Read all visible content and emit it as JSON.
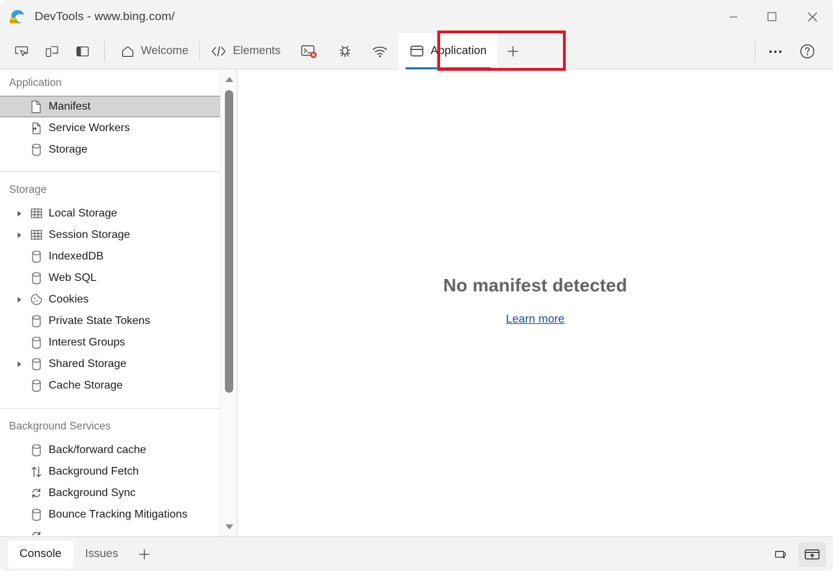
{
  "window": {
    "title": "DevTools - www.bing.com/",
    "logo_icon": "edge-devtools-logo-icon",
    "controls": [
      {
        "name": "minimize-button",
        "icon": "minimize-icon"
      },
      {
        "name": "maximize-button",
        "icon": "maximize-icon"
      },
      {
        "name": "close-button",
        "icon": "close-icon"
      }
    ]
  },
  "colors": {
    "accent": "#1a73c8",
    "highlight": "#e81123",
    "link": "#1a4fa0",
    "selection_bg": "#d4d4d4"
  },
  "toolbar": {
    "tools": [
      {
        "name": "inspect-element-button",
        "icon": "inspect-cursor-icon"
      },
      {
        "name": "device-emulation-button",
        "icon": "device-toolbar-icon"
      },
      {
        "name": "dock-side-button",
        "icon": "panel-layout-icon"
      }
    ],
    "tabs": [
      {
        "label": "Welcome",
        "icon": "home-icon",
        "active": false
      },
      {
        "label": "Elements",
        "icon": "code-brackets-icon",
        "active": false
      },
      {
        "label": "",
        "icon": "console-error-icon",
        "active": false,
        "icon_only": true
      },
      {
        "label": "",
        "icon": "bug-debugger-icon",
        "active": false,
        "icon_only": true
      },
      {
        "label": "",
        "icon": "network-wifi-icon",
        "active": false,
        "icon_only": true
      },
      {
        "label": "Application",
        "icon": "application-panel-icon",
        "active": true
      }
    ],
    "add_tab_label": "+",
    "add_tab_name": "more-tools-button",
    "more_options_icon": "ellipsis-icon",
    "help_icon": "help-question-icon"
  },
  "sidebar": {
    "sections": [
      {
        "title": "Application",
        "items": [
          {
            "label": "Manifest",
            "icon": "manifest-document-icon",
            "selected": true,
            "expandable": false
          },
          {
            "label": "Service Workers",
            "icon": "service-worker-icon",
            "selected": false,
            "expandable": false
          },
          {
            "label": "Storage",
            "icon": "database-icon",
            "selected": false,
            "expandable": false
          }
        ]
      },
      {
        "title": "Storage",
        "items": [
          {
            "label": "Local Storage",
            "icon": "table-grid-icon",
            "selected": false,
            "expandable": true
          },
          {
            "label": "Session Storage",
            "icon": "table-grid-icon",
            "selected": false,
            "expandable": true
          },
          {
            "label": "IndexedDB",
            "icon": "database-icon",
            "selected": false,
            "expandable": false
          },
          {
            "label": "Web SQL",
            "icon": "database-icon",
            "selected": false,
            "expandable": false
          },
          {
            "label": "Cookies",
            "icon": "cookie-icon",
            "selected": false,
            "expandable": true
          },
          {
            "label": "Private State Tokens",
            "icon": "database-icon",
            "selected": false,
            "expandable": false
          },
          {
            "label": "Interest Groups",
            "icon": "database-icon",
            "selected": false,
            "expandable": false
          },
          {
            "label": "Shared Storage",
            "icon": "database-icon",
            "selected": false,
            "expandable": true
          },
          {
            "label": "Cache Storage",
            "icon": "database-icon",
            "selected": false,
            "expandable": false
          }
        ]
      },
      {
        "title": "Background Services",
        "items": [
          {
            "label": "Back/forward cache",
            "icon": "database-icon",
            "selected": false,
            "expandable": false
          },
          {
            "label": "Background Fetch",
            "icon": "arrows-up-down-icon",
            "selected": false,
            "expandable": false
          },
          {
            "label": "Background Sync",
            "icon": "sync-circular-arrows-icon",
            "selected": false,
            "expandable": false
          },
          {
            "label": "Bounce Tracking Mitigations",
            "icon": "database-icon",
            "selected": false,
            "expandable": false
          },
          {
            "label": "",
            "icon": "sync-circular-arrows-icon",
            "selected": false,
            "expandable": false,
            "clipped": true
          }
        ]
      }
    ],
    "scrollbar": {
      "up_arrow_name": "scroll-up-arrow",
      "down_arrow_name": "scroll-down-arrow",
      "thumb_name": "sidebar-scroll-thumb"
    }
  },
  "main": {
    "empty_title": "No manifest detected",
    "learn_more_label": "Learn more"
  },
  "drawer": {
    "tabs": [
      {
        "label": "Console",
        "active": true
      },
      {
        "label": "Issues",
        "active": false
      }
    ],
    "add_label": "+",
    "add_name": "more-drawer-tools-button",
    "actions": [
      {
        "name": "restore-drawer-button",
        "icon": "dock-restore-icon",
        "active": false
      },
      {
        "name": "close-drawer-button",
        "icon": "panel-up-icon",
        "active": true
      }
    ]
  }
}
